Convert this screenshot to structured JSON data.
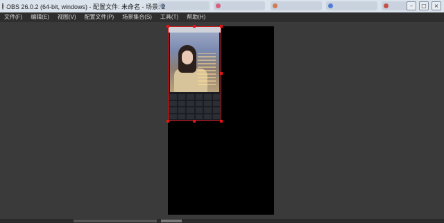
{
  "window": {
    "title": "OBS 26.0.2 (64-bit, windows) - 配置文件: 未命名 - 场景: 2"
  },
  "menubar": {
    "items": [
      {
        "label": "文件(F)"
      },
      {
        "label": "编辑(E)"
      },
      {
        "label": "视图(V)"
      },
      {
        "label": "配置文件(P)"
      },
      {
        "label": "场景集合(S)"
      },
      {
        "label": "工具(T)"
      },
      {
        "label": "帮助(H)"
      }
    ]
  },
  "controls": {
    "minimize_icon": "minimize-icon",
    "maximize_icon": "maximize-icon",
    "close_icon": "close-icon"
  },
  "colors": {
    "selection": "#e51515",
    "canvas": "#000000",
    "workspace": "#3a3a3a"
  }
}
